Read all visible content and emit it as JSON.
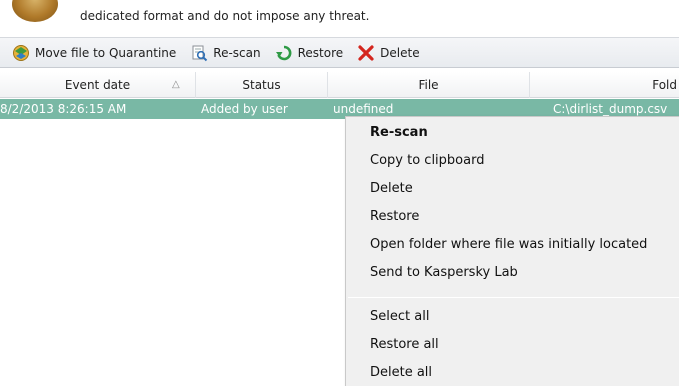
{
  "info": {
    "description": "dedicated format and do not impose any threat."
  },
  "toolbar": {
    "quarantine_label": "Move file to Quarantine",
    "rescan_label": "Re-scan",
    "restore_label": "Restore",
    "delete_label": "Delete"
  },
  "table": {
    "columns": [
      "Event date",
      "Status",
      "File",
      "Fold"
    ],
    "sort_indicator": "△",
    "rows": [
      {
        "event_date": "8/2/2013 8:26:15 AM",
        "status": "Added by user",
        "file": "undefined",
        "folder": "C:\\dirlist_dump.csv"
      }
    ]
  },
  "context_menu": {
    "items": [
      "Re-scan",
      "Copy to clipboard",
      "Delete",
      "Restore",
      "Open folder where file was initially located",
      "Send to Kaspersky Lab",
      "Select all",
      "Restore all",
      "Delete all"
    ]
  },
  "colors": {
    "selection": "#79b8a5",
    "delete_icon": "#d4261e",
    "restore_icon": "#2e9a45"
  }
}
